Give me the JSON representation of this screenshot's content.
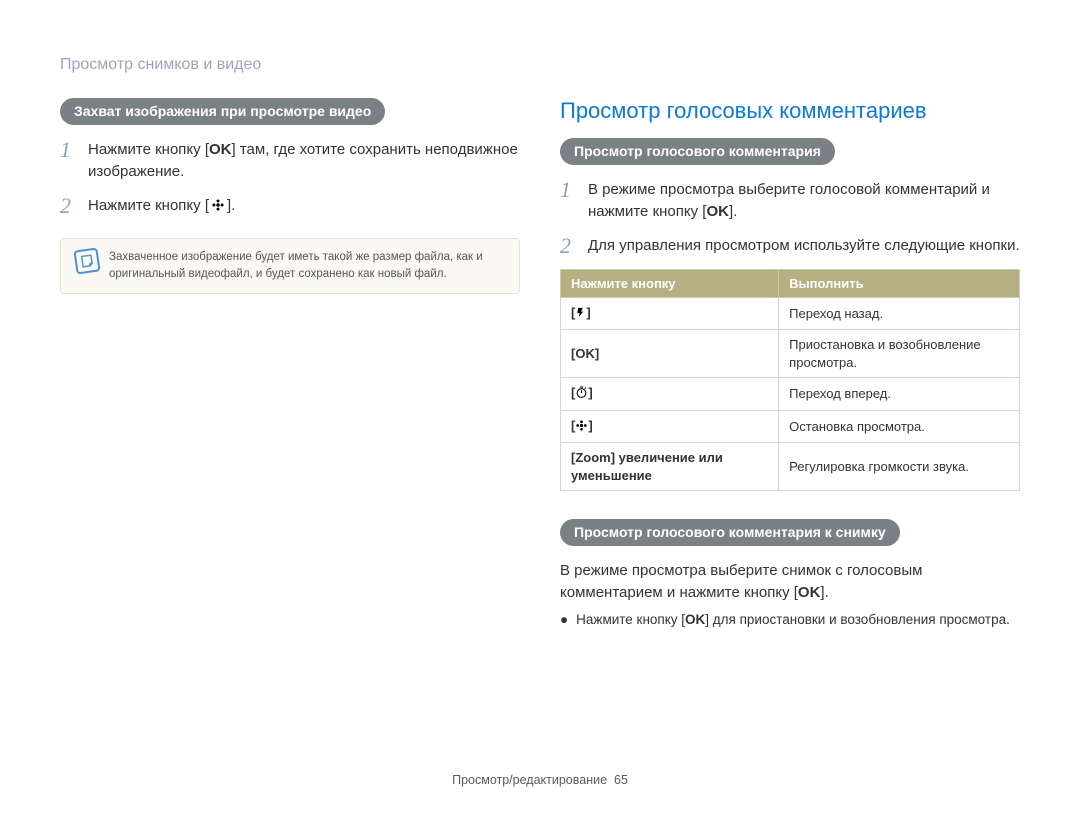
{
  "breadcrumb": "Просмотр снимков и видео",
  "left": {
    "pill": "Захват изображения при просмотре видео",
    "step1_a": "Нажмите кнопку [",
    "step1_ok": "OK",
    "step1_b": "] там, где хотите сохранить неподвижное изображение.",
    "step2_a": "Нажмите кнопку [",
    "step2_b": "].",
    "note": "Захваченное изображение будет иметь такой же размер файла, как и оригинальный видеофайл, и будет сохранено как новый файл."
  },
  "right": {
    "heading": "Просмотр голосовых комментариев",
    "pill1": "Просмотр голосового комментария",
    "step1_a": "В режиме просмотра выберите голосовой комментарий и нажмите кнопку [",
    "step1_ok": "OK",
    "step1_b": "].",
    "step2": "Для управления просмотром используйте следующие кнопки.",
    "table": {
      "h1": "Нажмите кнопку",
      "h2": "Выполнить",
      "rows": [
        {
          "key_type": "flash",
          "action": "Переход назад."
        },
        {
          "key_type": "ok",
          "label": "OK",
          "action": "Приостановка и возобновление просмотра."
        },
        {
          "key_type": "timer",
          "action": "Переход вперед."
        },
        {
          "key_type": "flower",
          "action": "Остановка просмотра."
        },
        {
          "key_type": "text",
          "label": "[Zoom] увеличение или уменьшение",
          "action": "Регулировка громкости звука."
        }
      ]
    },
    "pill2": "Просмотр голосового комментария к снимку",
    "para_a": "В режиме просмотра выберите снимок с голосовым комментарием и нажмите кнопку [",
    "para_ok": "OK",
    "para_b": "].",
    "bullet_a": "Нажмите кнопку [",
    "bullet_ok": "OK",
    "bullet_b": "] для приостановки и возобновления просмотра."
  },
  "footer": {
    "label": "Просмотр/редактирование",
    "page": "65"
  }
}
